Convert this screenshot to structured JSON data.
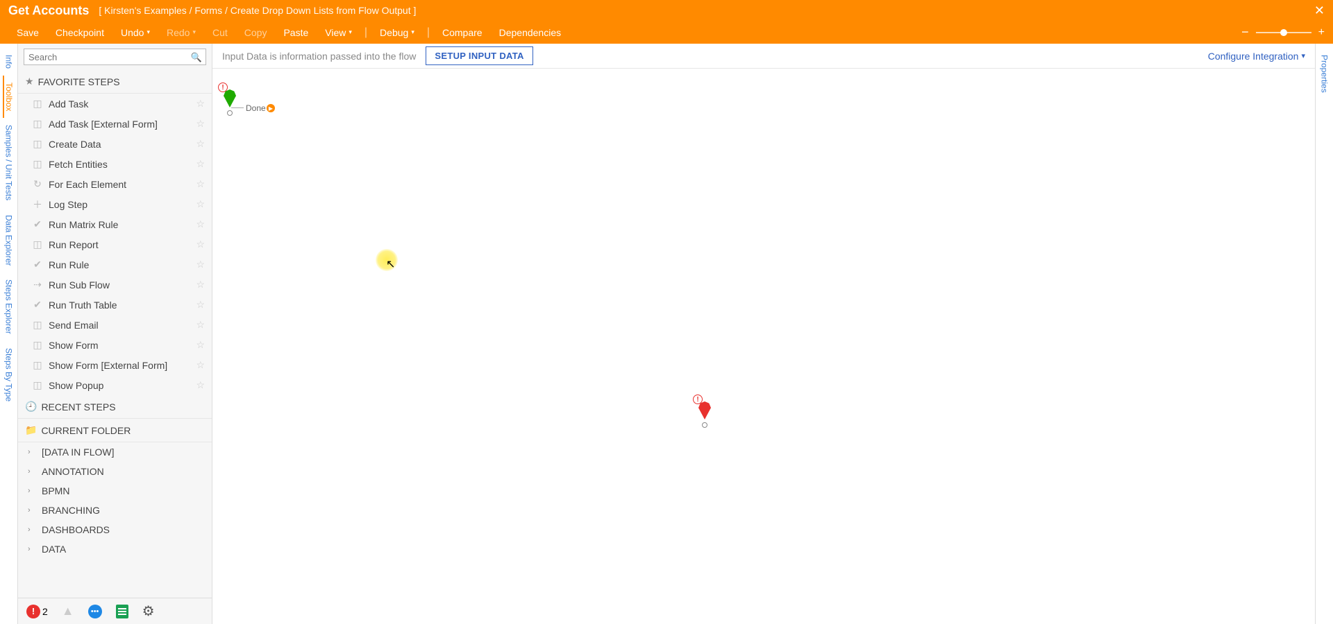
{
  "header": {
    "title": "Get Accounts",
    "breadcrumb": "[ Kirsten's Examples / Forms / Create Drop Down Lists from Flow Output ]",
    "close_label": "✕"
  },
  "menu": {
    "save": "Save",
    "checkpoint": "Checkpoint",
    "undo": "Undo",
    "redo": "Redo",
    "cut": "Cut",
    "copy": "Copy",
    "paste": "Paste",
    "view": "View",
    "debug": "Debug",
    "compare": "Compare",
    "dependencies": "Dependencies",
    "zoom_minus": "−",
    "zoom_plus": "+"
  },
  "left_tabs": {
    "info": "Info",
    "toolbox": "Toolbox",
    "samples": "Samples / Unit Tests",
    "data_explorer": "Data Explorer",
    "steps_explorer": "Steps Explorer",
    "steps_by_type": "Steps By Type"
  },
  "search": {
    "placeholder": "Search"
  },
  "sections": {
    "favorite": "FAVORITE STEPS",
    "recent": "RECENT STEPS",
    "current": "CURRENT FOLDER"
  },
  "favorites": [
    "Add Task",
    "Add Task [External Form]",
    "Create Data",
    "Fetch Entities",
    "For Each Element",
    "Log Step",
    "Run Matrix Rule",
    "Run Report",
    "Run Rule",
    "Run Sub Flow",
    "Run Truth Table",
    "Send Email",
    "Show Form",
    "Show Form [External Form]",
    "Show Popup"
  ],
  "tree": [
    "[DATA IN FLOW]",
    "ANNOTATION",
    "BPMN",
    "BRANCHING",
    "DASHBOARDS",
    "DATA"
  ],
  "bottom": {
    "error_count": "2"
  },
  "canvas_bar": {
    "info": "Input Data is information passed into the flow",
    "setup": "SETUP INPUT DATA",
    "configure": "Configure Integration"
  },
  "canvas": {
    "done": "Done",
    "exclaim": "!"
  },
  "right_tabs": {
    "properties": "Properties"
  }
}
